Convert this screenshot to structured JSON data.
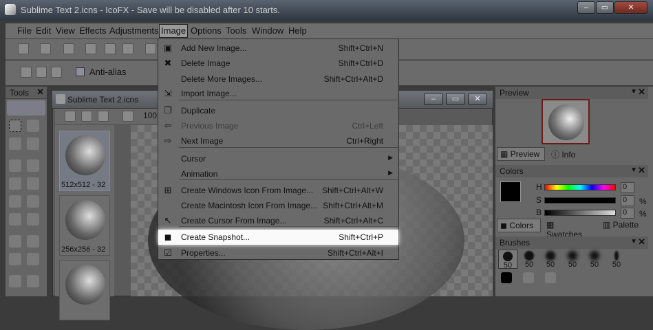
{
  "window": {
    "title": "Sublime Text 2.icns - IcoFX - Save will be disabled after 10 starts."
  },
  "menubar": [
    "File",
    "Edit",
    "View",
    "Effects",
    "Adjustments",
    "Image",
    "Options",
    "Tools",
    "Window",
    "Help"
  ],
  "toolbar": {
    "antialias": "Anti-alias"
  },
  "tools_panel": {
    "title": "Tools"
  },
  "document": {
    "title": "Sublime Text 2.icns",
    "zoom": "100",
    "thumbs": [
      "512x512 - 32",
      "256x256 - 32"
    ]
  },
  "preview": {
    "title": "Preview",
    "tabs": [
      "Preview",
      "Info"
    ]
  },
  "colors": {
    "title": "Colors",
    "h": "H",
    "s": "S",
    "b": "B",
    "h_val": "0",
    "s_val": "0",
    "b_val": "0",
    "pct": "%",
    "tabs": [
      "Colors",
      "Swatches",
      "Palette"
    ]
  },
  "brushes": {
    "title": "Brushes",
    "sizes": [
      "50",
      "50",
      "50",
      "50",
      "50",
      "50"
    ]
  },
  "image_menu": {
    "items": [
      {
        "label": "Add New Image...",
        "shortcut": "Shift+Ctrl+N",
        "icon": "add-image-icon"
      },
      {
        "label": "Delete Image",
        "shortcut": "Shift+Ctrl+D",
        "icon": "delete-icon"
      },
      {
        "label": "Delete More Images...",
        "shortcut": "Shift+Ctrl+Alt+D",
        "icon": ""
      },
      {
        "label": "Import Image...",
        "shortcut": "",
        "icon": "import-icon"
      },
      {
        "label": "Duplicate",
        "shortcut": "",
        "icon": "duplicate-icon"
      },
      {
        "label": "Previous Image",
        "shortcut": "Ctrl+Left",
        "icon": "arrow-left-icon"
      },
      {
        "label": "Next Image",
        "shortcut": "Ctrl+Right",
        "icon": "arrow-right-icon"
      },
      {
        "label": "Cursor",
        "shortcut": "",
        "icon": ""
      },
      {
        "label": "Animation",
        "shortcut": "",
        "icon": ""
      },
      {
        "label": "Create Windows Icon From Image...",
        "shortcut": "Shift+Ctrl+Alt+W",
        "icon": "windows-icon"
      },
      {
        "label": "Create Macintosh Icon From Image...",
        "shortcut": "Shift+Ctrl+Alt+M",
        "icon": "apple-icon"
      },
      {
        "label": "Create Cursor From Image...",
        "shortcut": "Shift+Ctrl+Alt+C",
        "icon": "cursor-icon"
      },
      {
        "label": "Create Snapshot...",
        "shortcut": "Shift+Ctrl+P",
        "icon": "snapshot-icon"
      },
      {
        "label": "Properties...",
        "shortcut": "Shift+Ctrl+Alt+I",
        "icon": "properties-icon"
      }
    ]
  }
}
